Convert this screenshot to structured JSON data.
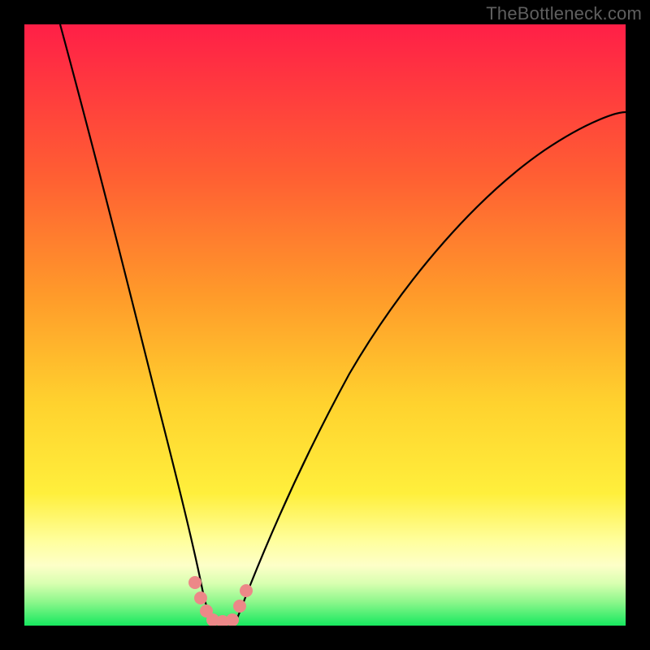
{
  "watermark": "TheBottleneck.com",
  "colors": {
    "gradient_top": "#ff1f47",
    "gradient_orange": "#ff8b2a",
    "gradient_yellow": "#ffe335",
    "gradient_paleyellow": "#ffff9a",
    "gradient_green": "#17e85f",
    "curve": "#000000",
    "dots": "#ec8888",
    "frame": "#000000"
  },
  "chart_data": {
    "type": "line",
    "title": "",
    "xlabel": "",
    "ylabel": "",
    "xlim": [
      0,
      100
    ],
    "ylim": [
      0,
      100
    ],
    "grid": false,
    "series": [
      {
        "name": "left-curve",
        "x": [
          6,
          10,
          14,
          18,
          22,
          25,
          27,
          28,
          29,
          30,
          31
        ],
        "y": [
          100,
          80,
          61,
          45,
          30,
          18,
          10,
          6,
          3,
          1.5,
          0
        ]
      },
      {
        "name": "right-curve",
        "x": [
          35,
          36,
          37,
          39,
          42,
          48,
          56,
          66,
          78,
          90,
          100
        ],
        "y": [
          0,
          3,
          6,
          11,
          18,
          30,
          44,
          57,
          69,
          78,
          85
        ]
      },
      {
        "name": "highlight-dots",
        "type": "scatter",
        "x": [
          28,
          29,
          30,
          31,
          33,
          35,
          36,
          37
        ],
        "y": [
          8,
          5,
          2,
          0.5,
          0.5,
          1,
          4,
          8
        ]
      }
    ],
    "min_point": {
      "x": 33,
      "y": 0
    }
  }
}
